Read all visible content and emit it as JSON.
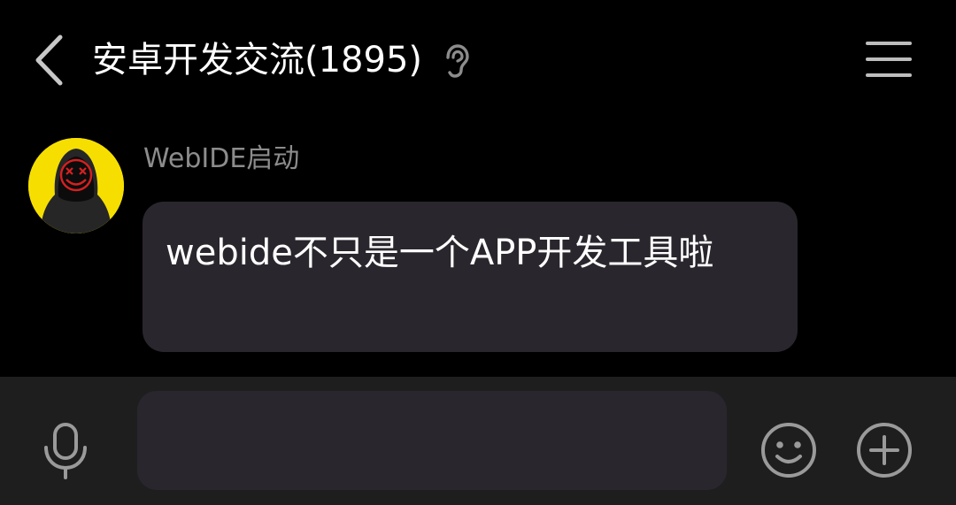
{
  "header": {
    "title": "安卓开发交流(1895)",
    "back_icon": "chevron-left-icon",
    "mode_icon": "ear-icon",
    "menu_icon": "hamburger-menu-icon"
  },
  "message": {
    "sender": "WebIDE启动",
    "text": "webide不只是一个APP开发工具啦",
    "avatar": "avatar-hooded-figure-smiley"
  },
  "input_bar": {
    "placeholder": "",
    "value": "",
    "voice_icon": "microphone-icon",
    "emoji_icon": "smiley-icon",
    "more_icon": "plus-circle-icon"
  },
  "colors": {
    "background": "#000000",
    "bubble": "#2a262d",
    "input_bar": "#1e1e1e",
    "avatar_bg": "#f6df00",
    "icon": "#9a9a9a"
  }
}
